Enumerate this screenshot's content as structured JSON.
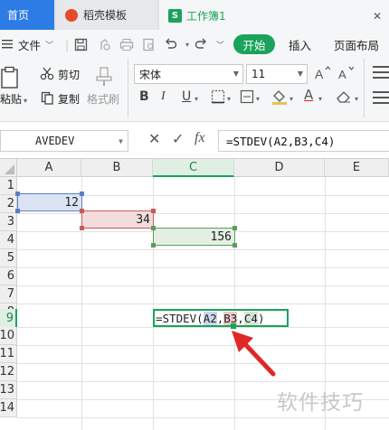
{
  "tabs": {
    "home": "首页",
    "docer": "稻壳模板",
    "workbook": "工作簿1",
    "workbook_icon": "S",
    "close": "✕"
  },
  "menu": {
    "file": "文件",
    "start": "开始",
    "insert": "插入",
    "page_layout": "页面布局"
  },
  "toolbar": {
    "paste": "粘贴",
    "cut": "剪切",
    "copy": "复制",
    "format_painter": "格式刷",
    "font_name": "宋体",
    "font_size": "11",
    "bold": "B",
    "italic": "I",
    "underline": "U",
    "font_color": "A"
  },
  "formula_bar": {
    "name_box": "AVEDEV",
    "cancel": "✕",
    "confirm": "✓",
    "fx": "fx",
    "formula": "=STDEV(A2,B3,C4)"
  },
  "sheet": {
    "columns": [
      "A",
      "B",
      "C",
      "D",
      "E"
    ],
    "selected_column": "C",
    "rows": [
      "1",
      "2",
      "3",
      "4",
      "5",
      "6",
      "7",
      "8",
      "9",
      "10",
      "11",
      "12",
      "13",
      "14"
    ],
    "selected_row": "9",
    "cells": {
      "A2": "12",
      "B3": "34",
      "C4": "156"
    },
    "edit": {
      "prefix": "=STDEV(",
      "ref_a": "A2",
      "sep1": ",",
      "ref_b": "B3",
      "sep2": ",",
      "ref_c": "C4",
      "suffix": ")"
    }
  },
  "colors": {
    "accent": "#1aa35b",
    "ref_a": "#5b7fc7",
    "ref_b": "#c75b5b",
    "ref_c": "#5b9c5b",
    "arrow": "#e02828"
  },
  "watermark": "软件技巧"
}
